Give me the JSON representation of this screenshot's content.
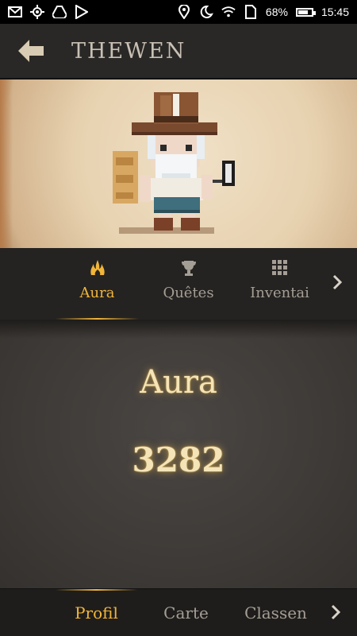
{
  "status_bar": {
    "left_icons": [
      "gmail-icon",
      "location-target-icon",
      "drive-icon",
      "play-store-icon"
    ],
    "right_icons": [
      "location-pin-icon",
      "alarm-icon",
      "wifi-icon",
      "sim-icon"
    ],
    "battery_percent": "68%",
    "battery_level": 0.68,
    "time": "15:45"
  },
  "header": {
    "title": "THEWEN",
    "back_icon": "back-arrow-icon"
  },
  "tabs": [
    {
      "label": "Aura",
      "icon": "aura-flame-icon",
      "active": true
    },
    {
      "label": "Quêtes",
      "icon": "trophy-icon",
      "active": false
    },
    {
      "label": "Inventai",
      "icon": "grid-icon",
      "active": false
    }
  ],
  "stat": {
    "title": "Aura",
    "value": "3282"
  },
  "bottom_nav": [
    {
      "label": "Profil",
      "active": true
    },
    {
      "label": "Carte",
      "active": false
    },
    {
      "label": "Classen",
      "active": false
    }
  ],
  "colors": {
    "accent": "#f0b53a",
    "inactive": "#a49e95",
    "header_bg": "#2a2826",
    "glow_text": "#f4e4b8"
  }
}
